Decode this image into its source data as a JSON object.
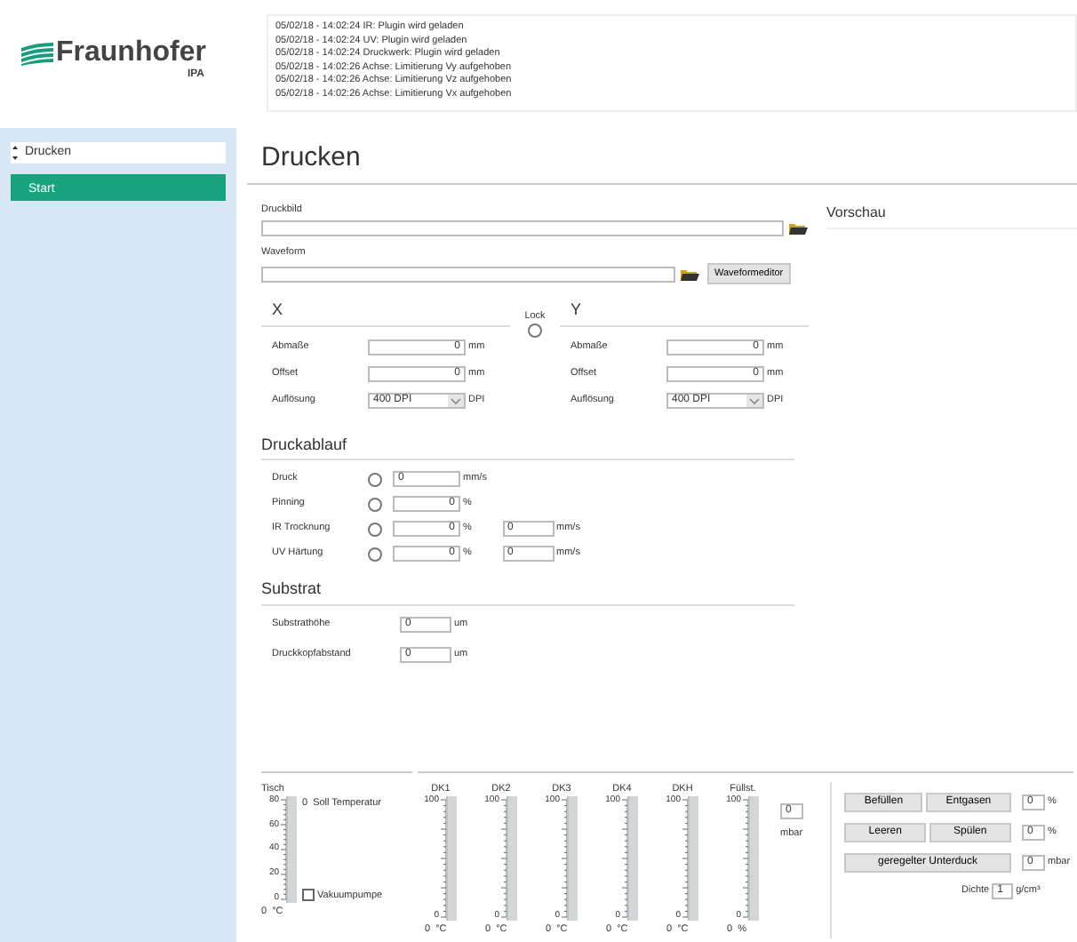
{
  "logo": {
    "name": "Fraunhofer",
    "sub": "IPA"
  },
  "log": [
    "05/02/18 - 14:02:24  IR: Plugin wird geladen",
    "05/02/18 - 14:02:24  UV: Plugin wird geladen",
    "05/02/18 - 14:02:24  Druckwerk: Plugin wird geladen",
    "05/02/18 - 14:02:26  Achse: Limitierung Vy aufgehoben",
    "05/02/18 - 14:02:26  Achse: Limitierung Vz aufgehoben",
    "05/02/18 - 14:02:26  Achse: Limitierung Vx aufgehoben"
  ],
  "sidebar": {
    "selector": "Drucken",
    "button": "Start"
  },
  "page_title": "Drucken",
  "files": [
    {
      "label": "Druckbild"
    },
    {
      "label": "Waveform",
      "button": "Waveformeditor"
    }
  ],
  "lock": {
    "label": "Lock",
    "on": false
  },
  "axes": [
    {
      "heading": "X",
      "rows": [
        {
          "kind": "number",
          "label": "Abmaße",
          "value": "0",
          "unit": "mm"
        },
        {
          "kind": "number",
          "label": "Offset",
          "value": "0",
          "unit": "mm"
        },
        {
          "kind": "select",
          "label": "Auflösung",
          "value": "400 DPI",
          "unit": "DPI"
        }
      ]
    },
    {
      "heading": "Y",
      "rows": [
        {
          "kind": "number",
          "label": "Abmaße",
          "value": "0",
          "unit": "mm"
        },
        {
          "kind": "number",
          "label": "Offset",
          "value": "0",
          "unit": "mm"
        },
        {
          "kind": "select",
          "label": "Auflösung",
          "value": "400 DPI",
          "unit": "DPI"
        }
      ]
    }
  ],
  "druckablauf": {
    "heading": "Druckablauf",
    "rows": [
      {
        "kind": "speed",
        "label": "Druck",
        "on": false,
        "value": "0",
        "unit": "mm/s"
      },
      {
        "kind": "percent",
        "label": "Pinning",
        "on": false,
        "value": "0",
        "unit": "%"
      },
      {
        "kind": "percent",
        "label": "IR Trocknung",
        "on": false,
        "value": "0",
        "unit": "%",
        "value2": "0",
        "unit2": "mm/s"
      },
      {
        "kind": "percent",
        "label": "UV Härtung",
        "on": false,
        "value": "0",
        "unit": "%",
        "value2": "0",
        "unit2": "mm/s"
      }
    ]
  },
  "substrat": {
    "heading": "Substrat",
    "rows": [
      {
        "label": "Substrathöhe",
        "value": "0",
        "unit": "um"
      },
      {
        "label": "Druckkopfabstand",
        "value": "0",
        "unit": "um"
      }
    ]
  },
  "preview": {
    "heading": "Vorschau"
  },
  "tisch": {
    "label": "Tisch",
    "ticks": [
      "80",
      "60",
      "40",
      "20",
      "0"
    ],
    "setpoint": "0",
    "setpoint_label": "Soll Temperatur",
    "vacuum": {
      "label": "Vakuumpumpe",
      "checked": false
    },
    "value": "0",
    "unit": "°C"
  },
  "gauges": [
    {
      "label": "DK1",
      "ticks": [
        "100",
        "0"
      ],
      "value": "0",
      "unit": "°C"
    },
    {
      "label": "DK2",
      "ticks": [
        "100",
        "0"
      ],
      "value": "0",
      "unit": "°C"
    },
    {
      "label": "DK3",
      "ticks": [
        "100",
        "0"
      ],
      "value": "0",
      "unit": "°C"
    },
    {
      "label": "DK4",
      "ticks": [
        "100",
        "0"
      ],
      "value": "0",
      "unit": "°C"
    },
    {
      "label": "DKH",
      "ticks": [
        "100",
        "0"
      ],
      "value": "0",
      "unit": "°C"
    },
    {
      "label": "Füllst.",
      "ticks": [
        "100",
        "0"
      ],
      "value": "0",
      "unit": "%"
    }
  ],
  "pressure": {
    "value": "0",
    "unit": "mbar"
  },
  "controls": [
    {
      "buttons": [
        "Befüllen",
        "Entgasen"
      ],
      "value": "0",
      "unit": "%"
    },
    {
      "buttons": [
        "Leeren",
        "Spülen"
      ],
      "value": "0",
      "unit": "%"
    },
    {
      "buttons": [
        "geregelter Unterduck"
      ],
      "value": "0",
      "unit": "mbar"
    }
  ],
  "density": {
    "label": "Dichte",
    "value": "1",
    "unit": "g/cm³"
  }
}
